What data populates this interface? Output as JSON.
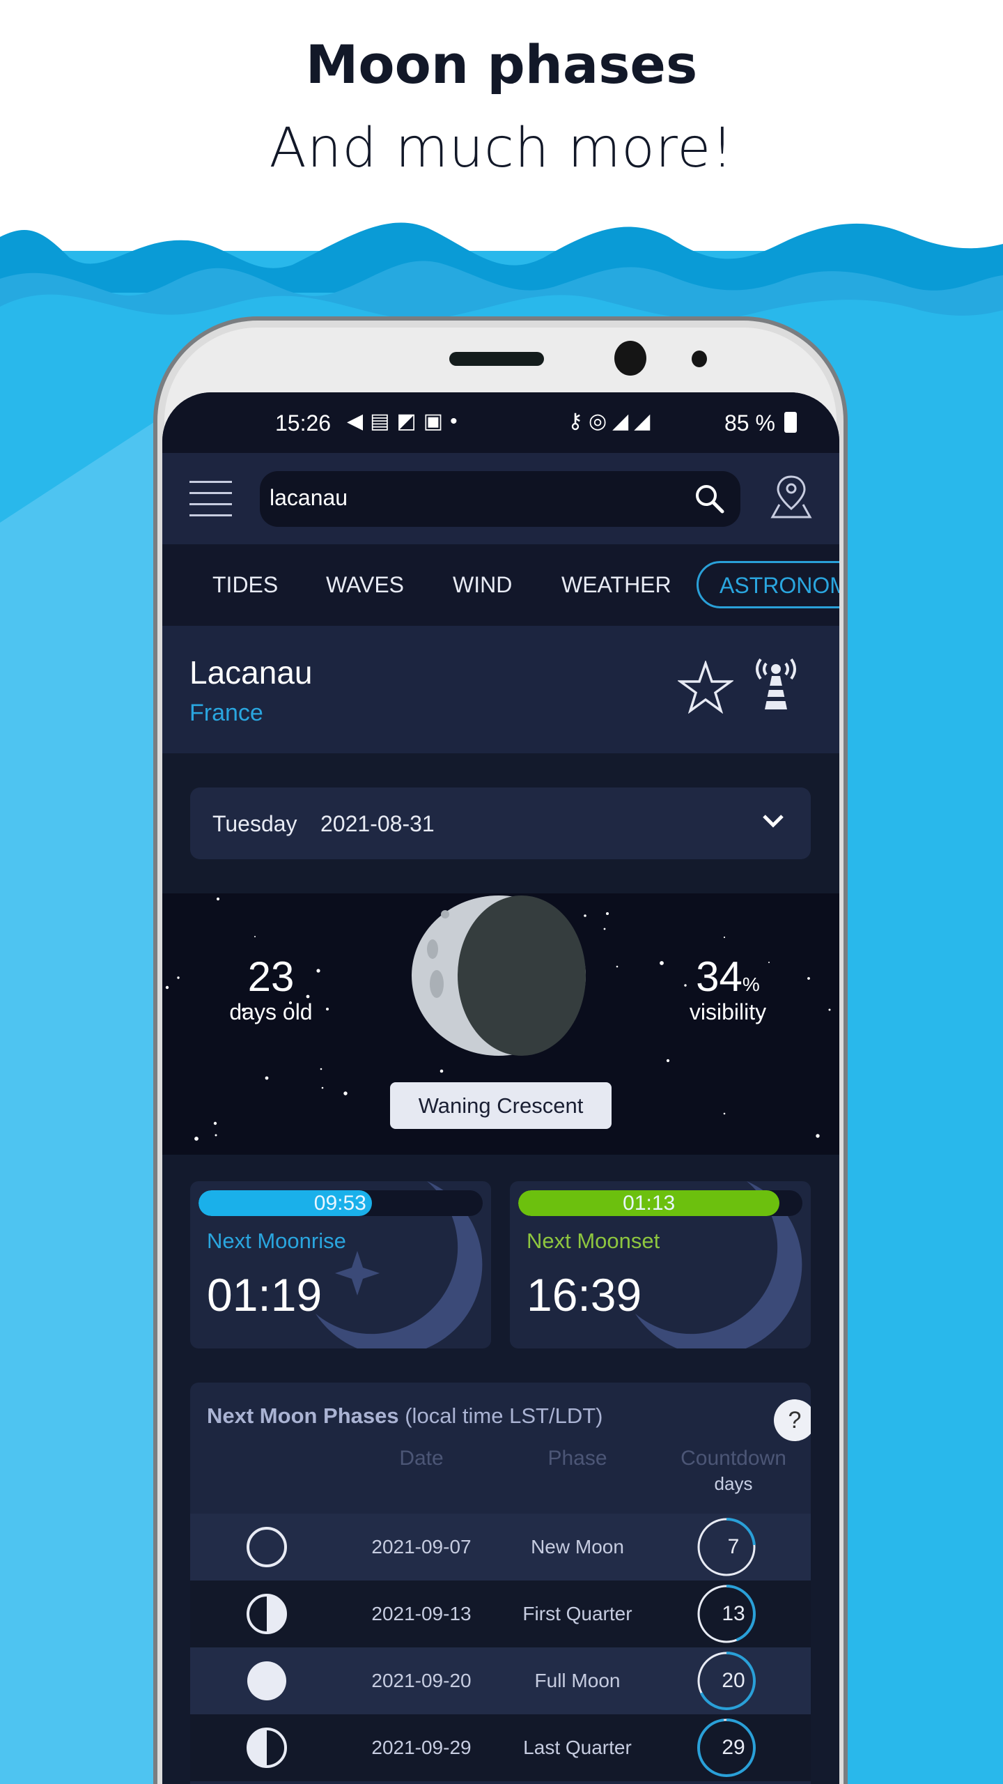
{
  "promo": {
    "headline": "Moon phases",
    "subline": "And much more!"
  },
  "colors": {
    "accent_blue": "#1ab0ea",
    "accent_green": "#6cc00e",
    "wave_dark": "#0a9bd6",
    "wave_mid": "#26a9e0",
    "wave_light": "#29b8eb"
  },
  "status_bar": {
    "time": "15:26",
    "battery": "85 %",
    "icons": [
      "telegram-icon",
      "message-icon",
      "note-icon",
      "contact-icon",
      "dot-icon",
      "key-icon",
      "hotspot-icon",
      "4g-signal-icon",
      "signal-icon",
      "battery-icon"
    ]
  },
  "header": {
    "search_value": "lacanau",
    "menu_icon": "hamburger-icon",
    "search_icon": "search-icon",
    "map_icon": "map-pin-icon"
  },
  "tabs": [
    {
      "label": "TIDES"
    },
    {
      "label": "WAVES"
    },
    {
      "label": "WIND"
    },
    {
      "label": "WEATHER"
    },
    {
      "label": "ASTRONOMY",
      "active": true
    }
  ],
  "location": {
    "name": "Lacanau",
    "country": "France"
  },
  "date_picker": {
    "day": "Tuesday",
    "date": "2021-08-31"
  },
  "moon": {
    "age": "23",
    "age_label": "days old",
    "visibility": "34",
    "visibility_unit": "%",
    "visibility_label": "visibility",
    "phase": "Waning Crescent",
    "illumination_percent": 34
  },
  "moonrise": {
    "countdown": "09:53",
    "label": "Next Moonrise",
    "time": "01:19",
    "progress": 0.61
  },
  "moonset": {
    "countdown": "01:13",
    "label": "Next Moonset",
    "time": "16:39",
    "progress": 0.92
  },
  "phases": {
    "title_bold": "Next Moon Phases",
    "title_rest": " (local time LST/LDT)",
    "help": "?",
    "columns": {
      "date": "Date",
      "phase": "Phase",
      "countdown": "Countdown",
      "countdown_unit": "days"
    },
    "rows": [
      {
        "icon": "new-moon",
        "date": "2021-09-07",
        "phase": "New Moon",
        "days": "7"
      },
      {
        "icon": "first-quarter",
        "date": "2021-09-13",
        "phase": "First Quarter",
        "days": "13"
      },
      {
        "icon": "full-moon",
        "date": "2021-09-20",
        "phase": "Full Moon",
        "days": "20"
      },
      {
        "icon": "last-quarter",
        "date": "2021-09-29",
        "phase": "Last Quarter",
        "days": "29"
      }
    ]
  }
}
